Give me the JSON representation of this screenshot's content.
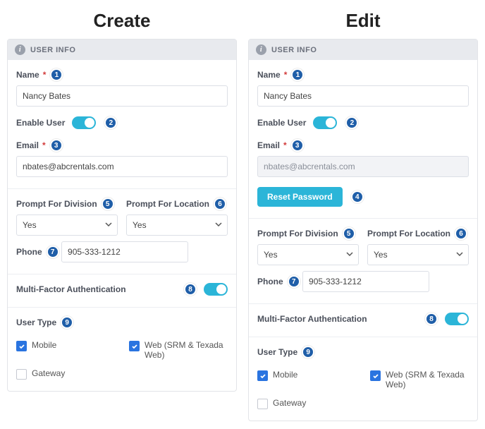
{
  "headings": {
    "create": "Create",
    "edit": "Edit"
  },
  "panel": {
    "header": "USER INFO"
  },
  "badges": {
    "n1": "1",
    "n2": "2",
    "n3": "3",
    "n4": "4",
    "n5": "5",
    "n6": "6",
    "n7": "7",
    "n8": "8",
    "n9": "9"
  },
  "labels": {
    "name": "Name",
    "enable_user": "Enable User",
    "email": "Email",
    "reset_password": "Reset Password",
    "prompt_division": "Prompt For Division",
    "prompt_location": "Prompt For Location",
    "phone": "Phone",
    "mfa": "Multi-Factor Authentication",
    "user_type": "User Type",
    "mobile": "Mobile",
    "web": "Web (SRM & Texada Web)",
    "gateway": "Gateway",
    "required": "*"
  },
  "values": {
    "name": "Nancy Bates",
    "email": "nbates@abcrentals.com",
    "prompt_division": "Yes",
    "prompt_location": "Yes",
    "phone": "905-333-1212"
  },
  "state": {
    "enable_user_on": true,
    "mfa_on": true,
    "mobile_checked": true,
    "web_checked": true,
    "gateway_checked": false
  },
  "colors": {
    "accent_cyan": "#2bb5d8",
    "accent_blue": "#2a74e0",
    "badge_blue": "#1f5ea8"
  }
}
